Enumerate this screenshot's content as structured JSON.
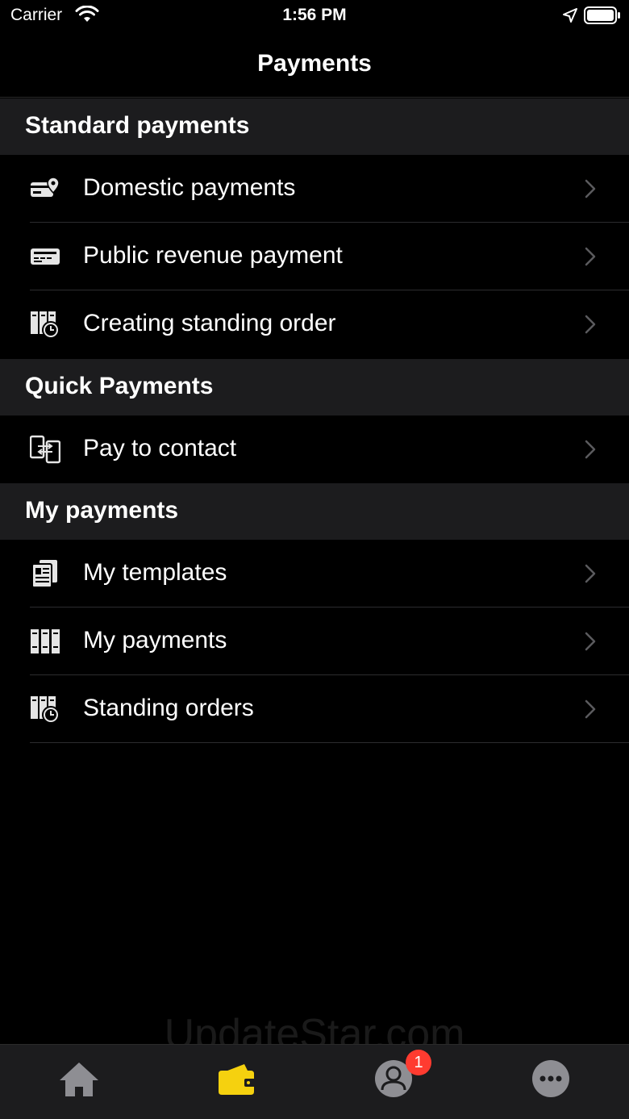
{
  "status_bar": {
    "carrier": "Carrier",
    "time": "1:56 PM"
  },
  "nav": {
    "title": "Payments"
  },
  "sections": [
    {
      "title": "Standard payments",
      "items": [
        {
          "label": "Domestic payments",
          "icon": "card-location-icon"
        },
        {
          "label": "Public revenue payment",
          "icon": "ticket-icon"
        },
        {
          "label": "Creating standing order",
          "icon": "binders-clock-icon"
        }
      ]
    },
    {
      "title": "Quick Payments",
      "items": [
        {
          "label": "Pay to contact",
          "icon": "phone-transfer-icon"
        }
      ]
    },
    {
      "title": "My payments",
      "items": [
        {
          "label": "My templates",
          "icon": "document-icon"
        },
        {
          "label": "My payments",
          "icon": "binders-icon"
        },
        {
          "label": "Standing orders",
          "icon": "binders-clock-icon"
        }
      ]
    }
  ],
  "watermark": "UpdateStar.com",
  "tab_bar": {
    "tabs": [
      {
        "name": "Home",
        "icon": "home-icon"
      },
      {
        "name": "Payments",
        "icon": "wallet-icon",
        "active": true
      },
      {
        "name": "Profile",
        "icon": "user-icon",
        "badge": "1"
      },
      {
        "name": "More",
        "icon": "more-icon"
      }
    ],
    "active_color": "#f5d10f",
    "inactive_color": "#8e8e93"
  }
}
